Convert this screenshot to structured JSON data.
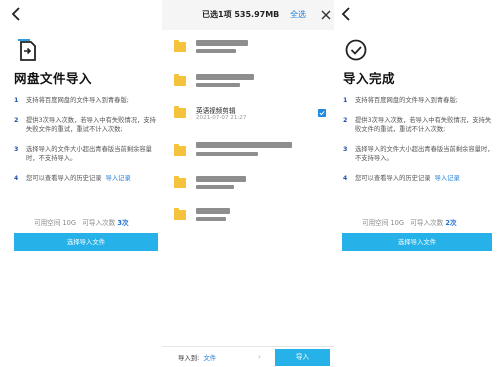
{
  "left": {
    "title": "网盘文件导入",
    "tips": [
      {
        "num": "1",
        "text": "支持将百度网盘的文件导入到青春版;"
      },
      {
        "num": "2",
        "text": "提供3次导入次数，若导入中有失败情况，支持失败文件的重试，重试不计入次数;"
      },
      {
        "num": "3",
        "text": "选择导入的文件大小超出青春版当前剩余容量时，不支持导入。"
      },
      {
        "num": "4",
        "text": "您可以查看导入的历史记录",
        "link": "导入记录"
      }
    ],
    "stats": {
      "space_label": "可用空间",
      "space_value": "10G",
      "count_label": "可导入次数",
      "count_value": "3次"
    },
    "button": "选择导入文件"
  },
  "middle": {
    "title": "已选1项 535.97MB",
    "select_all": "全选",
    "files": [
      {
        "name": "",
        "date": "",
        "redacted": true
      },
      {
        "name": "",
        "date": "",
        "redacted": true
      },
      {
        "name": "英语视频剪辑",
        "date": "2021-07-07 21:27",
        "redacted": false,
        "checked": true
      },
      {
        "name": "",
        "date": "",
        "redacted": true
      },
      {
        "name": "",
        "date": "",
        "redacted": true
      },
      {
        "name": "",
        "date": "",
        "redacted": true
      }
    ],
    "footer": {
      "import_to_label": "导入到:",
      "destination": "文件",
      "import_button": "导入"
    }
  },
  "right": {
    "title": "导入完成",
    "tips": [
      {
        "num": "1",
        "text": "支持将百度网盘的文件导入到青春版;"
      },
      {
        "num": "2",
        "text": "提供3次导入次数，若导入中有失败情况，支持失败文件的重试，重试不计入次数;"
      },
      {
        "num": "3",
        "text": "选择导入的文件大小超出青春版当前剩余容量时，不支持导入。"
      },
      {
        "num": "4",
        "text": "您可以查看导入的历史记录",
        "link": "导入记录"
      }
    ],
    "stats": {
      "space_label": "可用空间",
      "space_value": "10G",
      "count_label": "可导入次数",
      "count_value": "2次"
    },
    "button": "选择导入文件"
  },
  "colors": {
    "accent": "#26b2e8",
    "link": "#1f7fd6",
    "folder": "#f5c33b"
  }
}
